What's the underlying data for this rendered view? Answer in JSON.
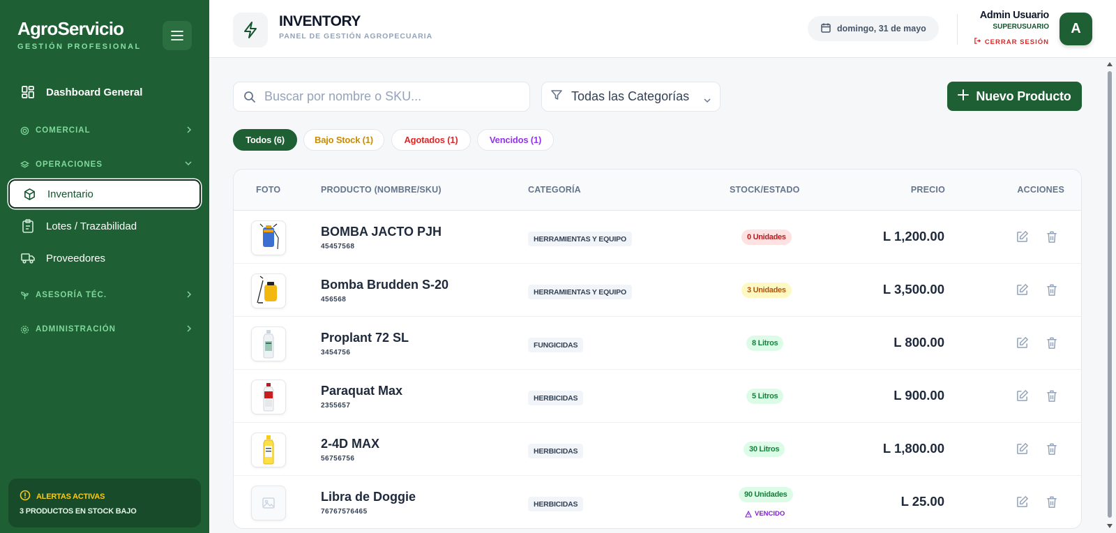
{
  "brand": {
    "name": "AgroServicio",
    "subtitle": "GESTIÓN PROFESIONAL"
  },
  "sidebar": {
    "dashboard": "Dashboard General",
    "sections": {
      "comercial": "COMERCIAL",
      "operaciones": "OPERACIONES",
      "asesoria": "ASESORÍA TÉC.",
      "administracion": "ADMINISTRACIÓN"
    },
    "items": {
      "inventario": "Inventario",
      "lotes": "Lotes / Trazabilidad",
      "proveedores": "Proveedores"
    },
    "alert": {
      "title": "ALERTAS ACTIVAS",
      "text": "3 PRODUCTOS EN STOCK BAJO"
    }
  },
  "header": {
    "title": "INVENTORY",
    "subtitle": "PANEL DE GESTIÓN AGROPECUARIA",
    "date": "domingo, 31 de mayo",
    "user_name": "Admin Usuario",
    "user_role": "SUPERUSUARIO",
    "logout": "CERRAR SESIÓN",
    "avatar_letter": "A"
  },
  "toolbar": {
    "search_placeholder": "Buscar por nombre o SKU...",
    "category_select": "Todas las Categorías",
    "new_button": "Nuevo Producto"
  },
  "filters": [
    {
      "label": "Todos (6)",
      "color": "#ffffff"
    },
    {
      "label": "Bajo Stock (1)",
      "color": "#ca8a04"
    },
    {
      "label": "Agotados (1)",
      "color": "#dc2626"
    },
    {
      "label": "Vencidos (1)",
      "color": "#9333ea"
    }
  ],
  "table": {
    "headers": {
      "foto": "FOTO",
      "producto": "PRODUCTO (NOMBRE/SKU)",
      "categoria": "CATEGORÍA",
      "stock": "STOCK/ESTADO",
      "precio": "PRECIO",
      "acciones": "ACCIONES"
    },
    "rows": [
      {
        "name": "BOMBA JACTO PJH",
        "sku": "45457568",
        "category": "HERRAMIENTAS Y EQUIPO",
        "stock": "0 Unidades",
        "status": "red",
        "price": "L 1,200.00",
        "image": "sprayer-blue",
        "expired": ""
      },
      {
        "name": "Bomba Brudden S-20",
        "sku": "456568",
        "category": "HERRAMIENTAS Y EQUIPO",
        "stock": "3 Unidades",
        "status": "amber",
        "price": "L 3,500.00",
        "image": "sprayer-yellow",
        "expired": ""
      },
      {
        "name": "Proplant 72 SL",
        "sku": "3454756",
        "category": "FUNGICIDAS",
        "stock": "8 Litros",
        "status": "green",
        "price": "L 800.00",
        "image": "bottle-white",
        "expired": ""
      },
      {
        "name": "Paraquat Max",
        "sku": "2355657",
        "category": "HERBICIDAS",
        "stock": "5 Litros",
        "status": "green",
        "price": "L 900.00",
        "image": "bottle-red",
        "expired": ""
      },
      {
        "name": "2-4D MAX",
        "sku": "56756756",
        "category": "HERBICIDAS",
        "stock": "30 Litros",
        "status": "green",
        "price": "L 1,800.00",
        "image": "bottle-yellow",
        "expired": ""
      },
      {
        "name": "Libra de Doggie",
        "sku": "76767576465",
        "category": "HERBICIDAS",
        "stock": "90 Unidades",
        "status": "green",
        "price": "L 25.00",
        "image": "image-placeholder",
        "expired": "VENCIDO"
      }
    ]
  }
}
